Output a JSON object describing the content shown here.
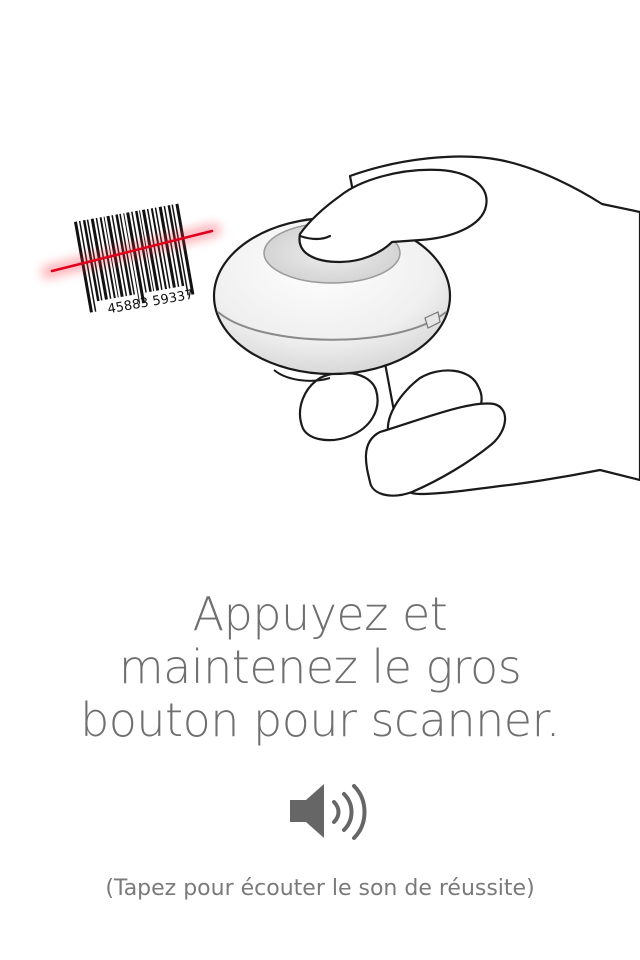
{
  "illustration": {
    "barcode_number": "45883 59337",
    "colors": {
      "laser": "#e0001b",
      "outline": "#1a1a1a",
      "scanner_body": "#f2f2f2",
      "scanner_button": "#dcdcdc"
    }
  },
  "instruction": {
    "line1": "Appuyez et",
    "line2": "maintenez le gros",
    "line3": "bouton pour scanner."
  },
  "sound": {
    "icon": "speaker-volume-icon"
  },
  "hint": {
    "text": "(Tapez pour écouter le son de réussite)"
  },
  "colors": {
    "text": "#6f6f6f",
    "icon": "#666666",
    "background": "#ffffff"
  }
}
